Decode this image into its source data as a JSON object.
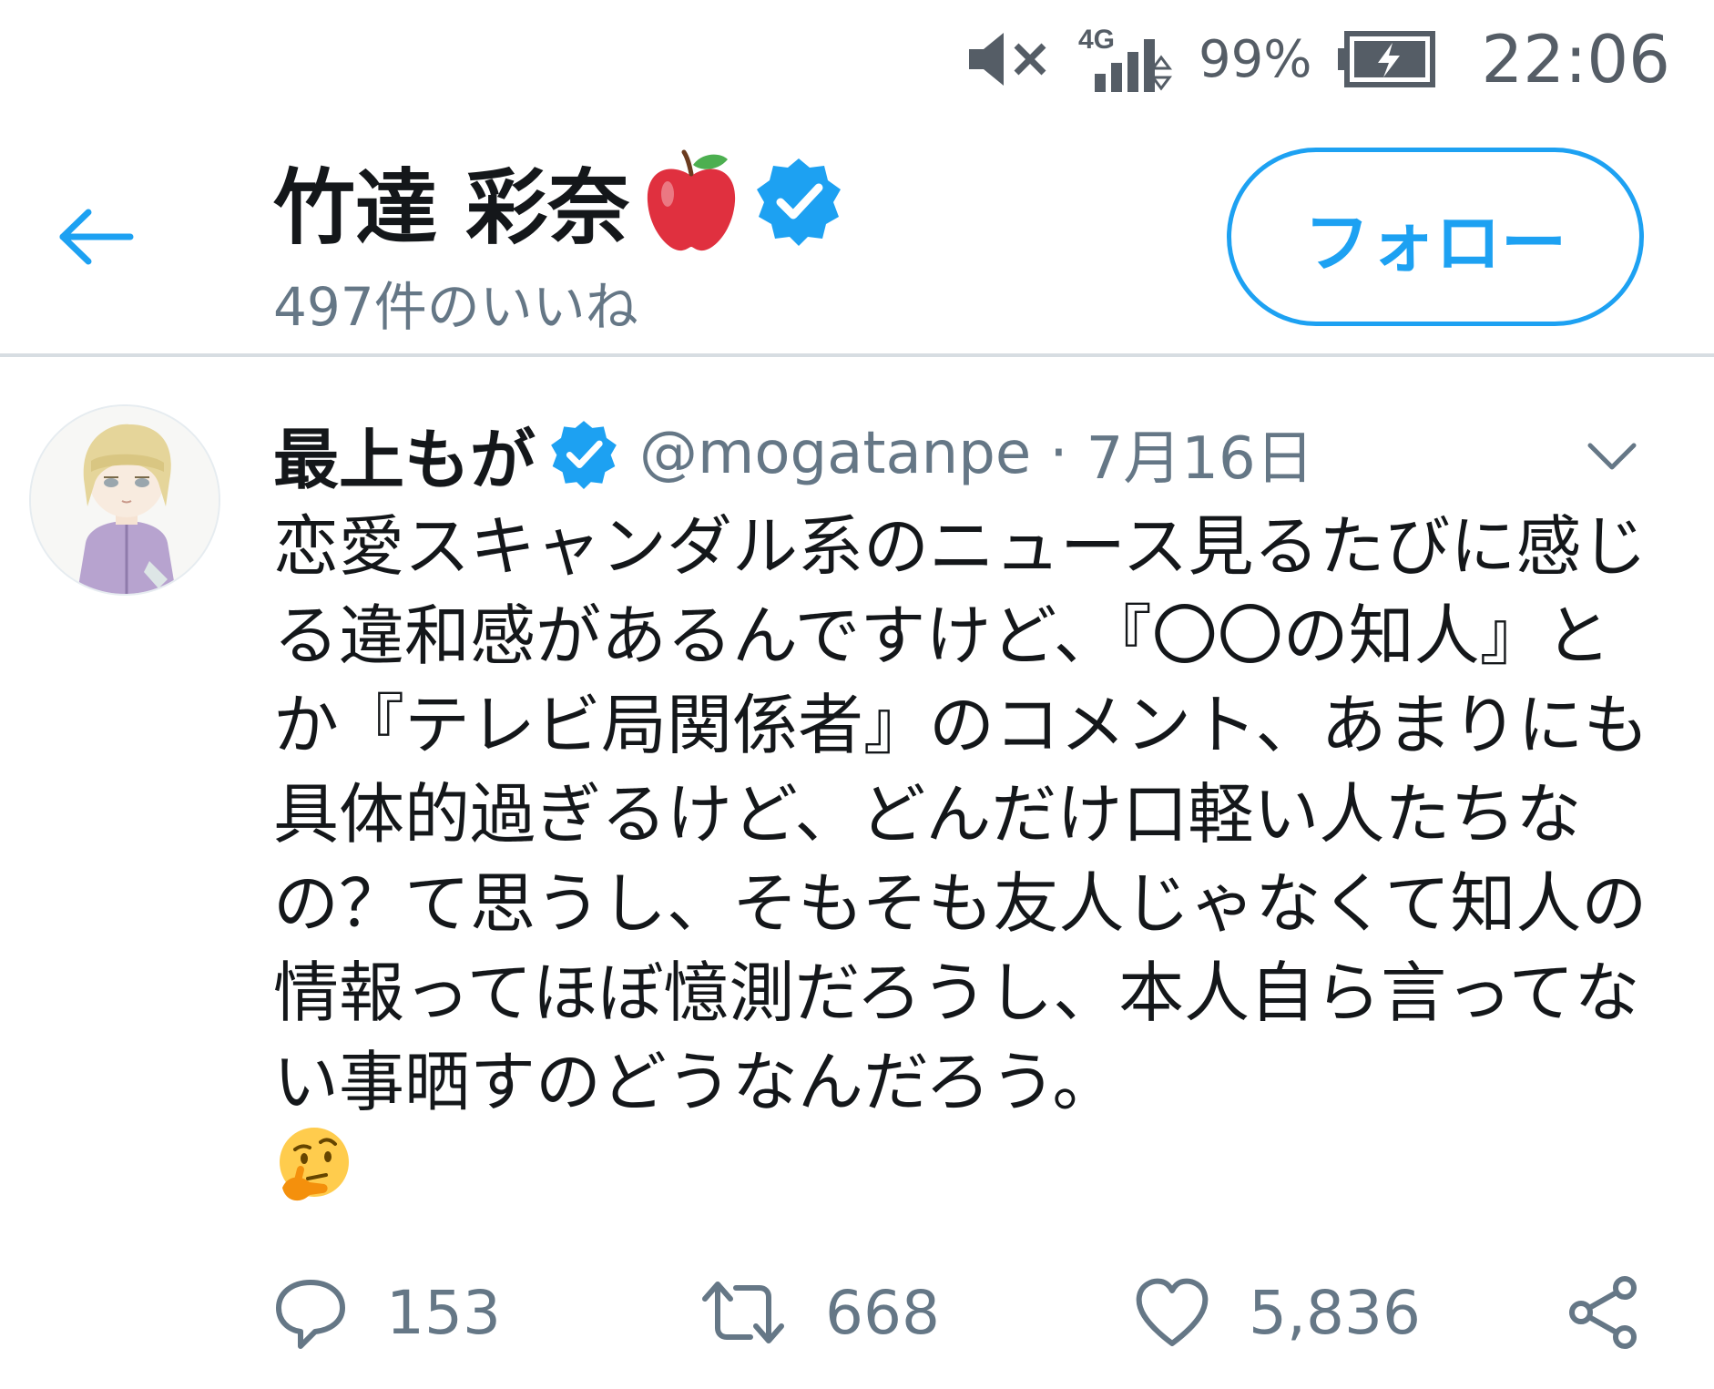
{
  "status_bar": {
    "network": "4G",
    "battery_percent": "99%",
    "time": "22:06"
  },
  "header": {
    "name": "竹達 彩奈",
    "likes_count_label": "497件のいいね",
    "follow_label": "フォロー"
  },
  "tweet": {
    "author_name": "最上もが",
    "handle": "@mogatanpe",
    "separator": "·",
    "date": "7月16日",
    "text": "恋愛スキャンダル系のニュース見るたびに感じる違和感があるんですけど、『〇〇の知人』とか『テレビ局関係者』のコメント、あまりにも具体的過ぎるけど、どんだけ口軽い人たちなの？て思うし、そもそも友人じゃなくて知人の情報ってほぼ憶測だろうし、本人自ら言ってない事晒すのどうなんだろう。",
    "replies": "153",
    "retweets": "668",
    "likes": "5,836"
  },
  "colors": {
    "accent": "#1da1f2",
    "secondary_text": "#657786",
    "primary_text": "#14171a",
    "divider": "#d7dde2",
    "apple_red": "#e0303f"
  },
  "icons": {
    "mute": "speaker-muted-icon",
    "signal": "signal-bars-icon",
    "battery": "battery-charging-icon",
    "back": "arrow-left-icon",
    "apple": "red-apple-emoji",
    "verified": "verified-badge-icon",
    "caret": "chevron-down-icon",
    "thinking": "thinking-face-emoji",
    "reply": "reply-bubble-icon",
    "retweet": "retweet-icon",
    "like": "heart-icon",
    "share": "share-icon"
  }
}
